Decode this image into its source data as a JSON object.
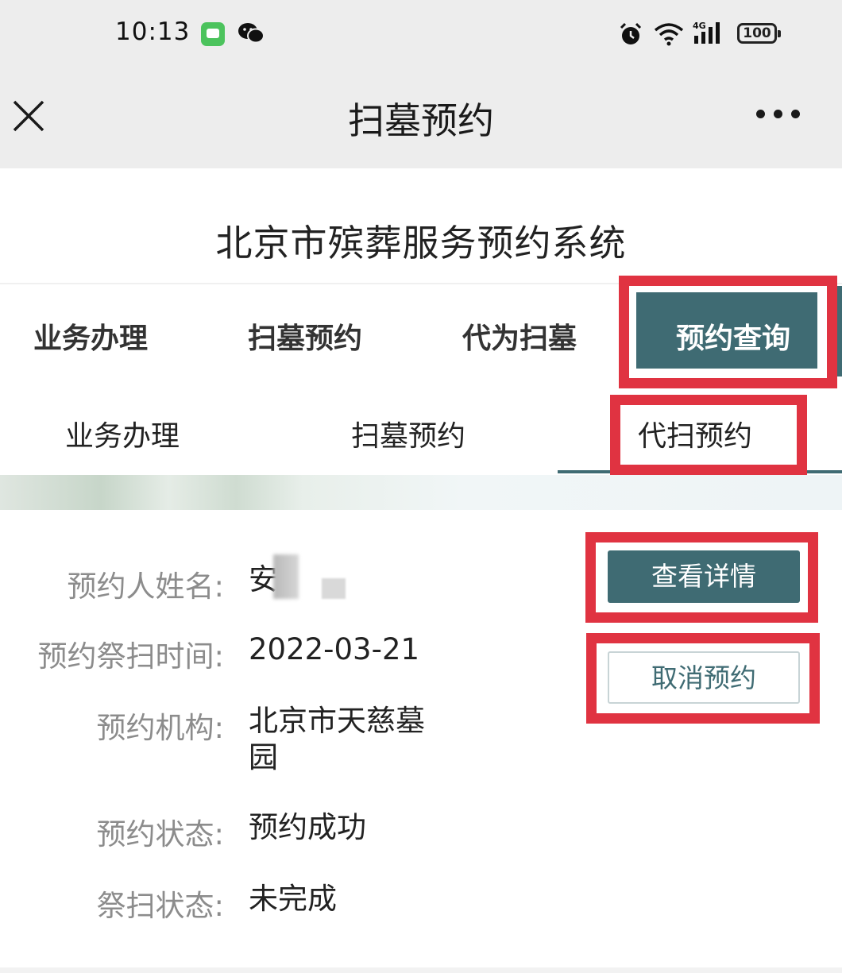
{
  "status_bar": {
    "time": "10:13",
    "network": "4G",
    "battery": "100",
    "icons": [
      "messages-app-icon",
      "wechat-icon",
      "alarm-icon",
      "wifi-icon",
      "cellular-signal-icon",
      "battery-icon"
    ]
  },
  "nav": {
    "title": "扫墓预约",
    "icons": [
      "close-icon",
      "more-icon"
    ]
  },
  "header": {
    "site_title": "北京市殡葬服务预约系统"
  },
  "main_tabs": [
    {
      "label": "业务办理",
      "active": false
    },
    {
      "label": "扫墓预约",
      "active": false
    },
    {
      "label": "代为扫墓",
      "active": false
    },
    {
      "label": "预约查询",
      "active": true
    }
  ],
  "sub_tabs": [
    {
      "label": "业务办理",
      "active": false
    },
    {
      "label": "扫墓预约",
      "active": false
    },
    {
      "label": "代扫预约",
      "active": true
    }
  ],
  "reservation": {
    "name_label": "预约人姓名:",
    "name_value": "安",
    "date_label": "预约祭扫时间:",
    "date_value": "2022-03-21",
    "org_label": "预约机构:",
    "org_value_line1": "北京市天慈墓",
    "org_value_line2": "园",
    "status_label": "预约状态:",
    "status_value": "预约成功",
    "visit_label": "祭扫状态:",
    "visit_value": "未完成"
  },
  "actions": {
    "detail_button": "查看详情",
    "cancel_button": "取消预约"
  },
  "colors": {
    "accent": "#3f6b73",
    "annotation_red": "#e03341",
    "bar_gray": "#ededed"
  }
}
